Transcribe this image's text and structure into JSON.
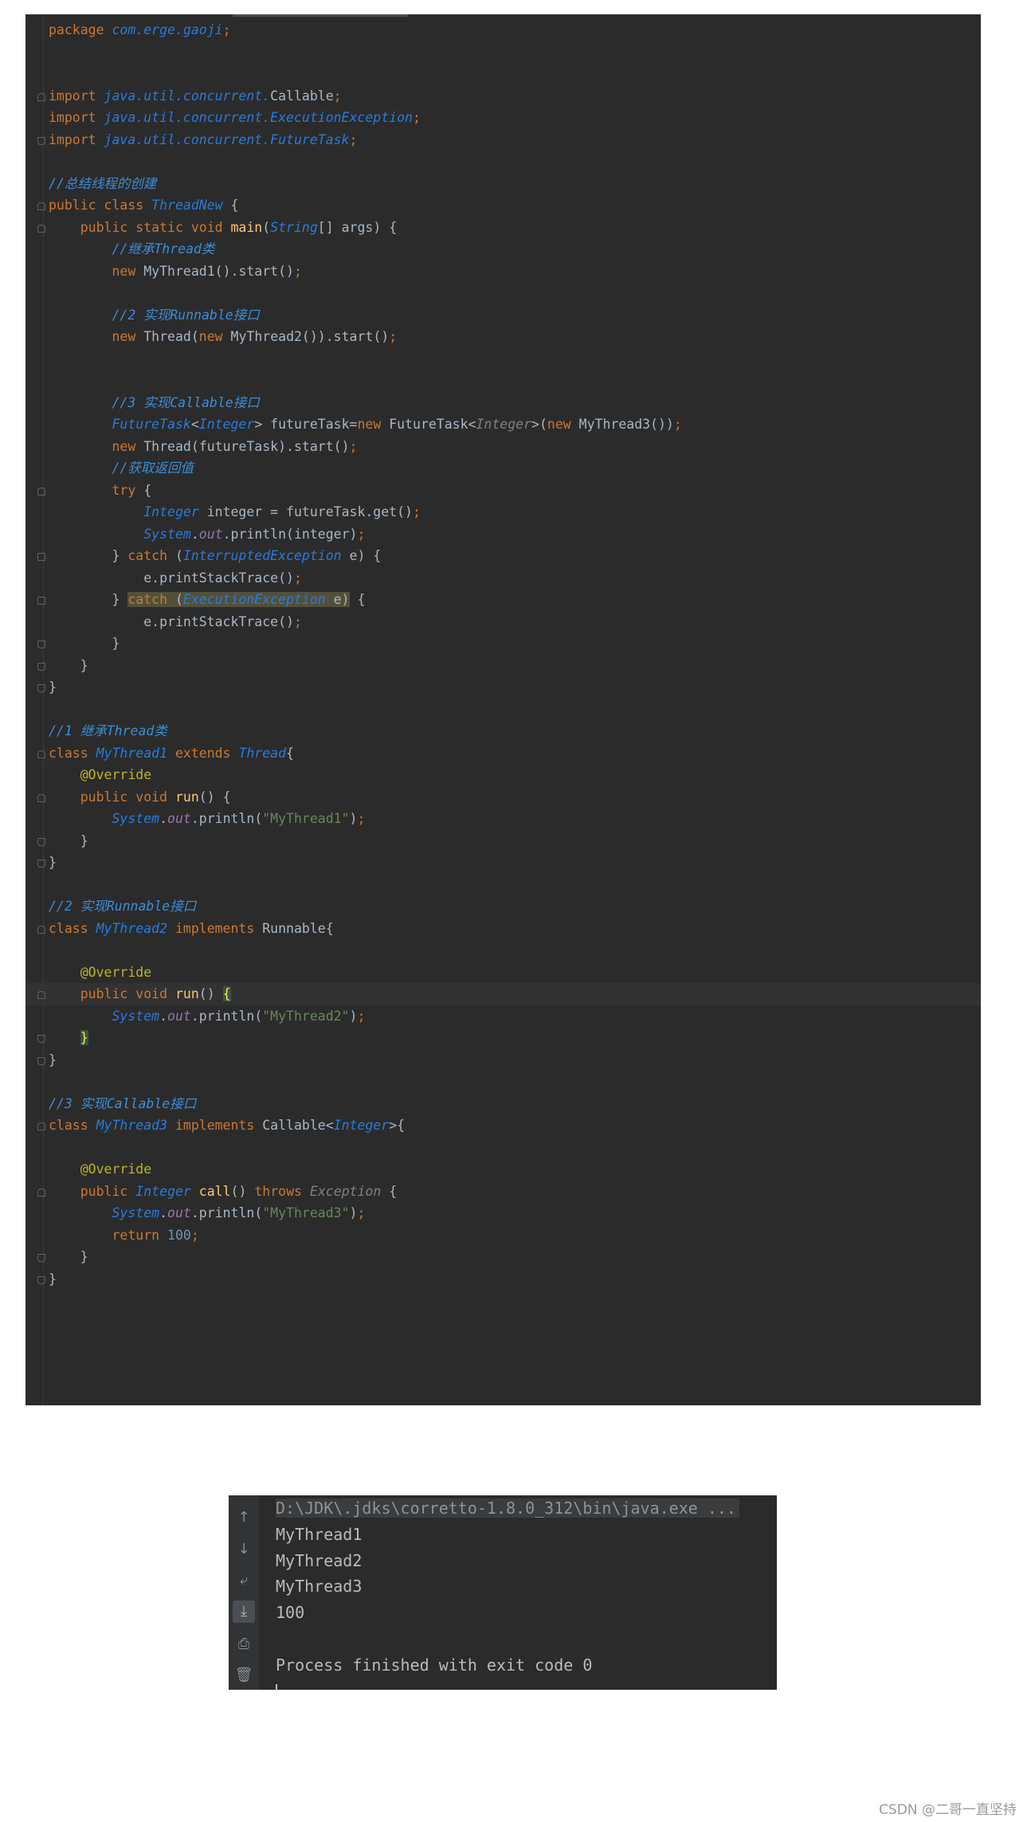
{
  "editor": {
    "lines": [
      "package com.erge.gaoji;",
      "",
      "",
      "import java.util.concurrent.Callable;",
      "import java.util.concurrent.ExecutionException;",
      "import java.util.concurrent.FutureTask;",
      "",
      "//总结线程的创建",
      "public class ThreadNew {",
      "    public static void main(String[] args) {",
      "        //继承Thread类",
      "        new MyThread1().start();",
      "",
      "        //2 实现Runnable接口",
      "        new Thread(new MyThread2()).start();",
      "",
      "",
      "        //3 实现Callable接口",
      "        FutureTask<Integer> futureTask=new FutureTask<Integer>(new MyThread3());",
      "        new Thread(futureTask).start();",
      "        //获取返回值",
      "        try {",
      "            Integer integer = futureTask.get();",
      "            System.out.println(integer);",
      "        } catch (InterruptedException e) {",
      "            e.printStackTrace();",
      "        } catch (ExecutionException e) {",
      "            e.printStackTrace();",
      "        }",
      "    }",
      "}",
      "",
      "//1 继承Thread类",
      "class MyThread1 extends Thread{",
      "    @Override",
      "    public void run() {",
      "        System.out.println(\"MyThread1\");",
      "    }",
      "}",
      "",
      "//2 实现Runnable接口",
      "class MyThread2 implements Runnable{",
      "",
      "    @Override",
      "    public void run() {",
      "        System.out.println(\"MyThread2\");",
      "    }",
      "}",
      "",
      "//3 实现Callable接口",
      "class MyThread3 implements Callable<Integer>{",
      "",
      "    @Override",
      "    public Integer call() throws Exception {",
      "        System.out.println(\"MyThread3\");",
      "        return 100;",
      "    }",
      "}"
    ]
  },
  "console": {
    "command": "D:\\JDK\\.jdks\\corretto-1.8.0_312\\bin\\java.exe ...",
    "output": [
      "MyThread1",
      "MyThread2",
      "MyThread3",
      "100",
      "",
      "Process finished with exit code 0"
    ],
    "tools": [
      "up-arrow-icon",
      "down-arrow-icon",
      "soft-wrap-icon",
      "scroll-to-end-icon",
      "print-icon",
      "trash-icon"
    ]
  },
  "watermark": "CSDN @二哥一直坚持",
  "colors": {
    "editor_bg": "#2b2b2b",
    "keyword": "#cc7832",
    "type": "#287bde",
    "comment": "#3c8dd8",
    "string": "#6a8759",
    "annotation": "#bbb529",
    "function": "#ffc66d",
    "number": "#6897bb"
  }
}
